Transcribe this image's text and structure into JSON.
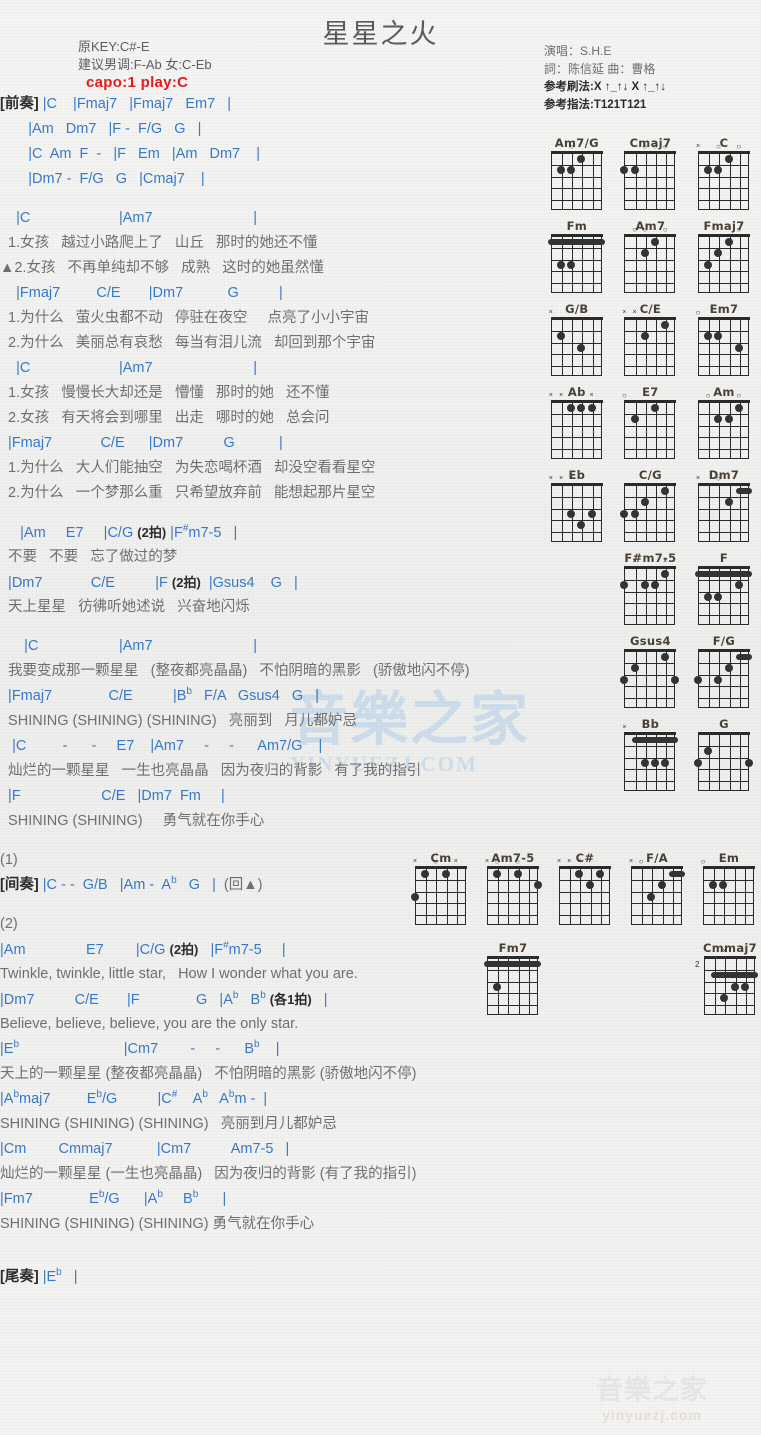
{
  "header": {
    "title": "星星之火",
    "orig_key": "原KEY:C#-E",
    "suggest_key": "建议男调:F-Ab 女:C-Eb",
    "capo": "capo:1 play:C",
    "singer": "演唱：S.H.E",
    "writer": "詞：陈信延   曲：曹格",
    "strum": "参考刷法:X ↑_↑↓ X ↑_↑↓",
    "fingering": "参考指法:T121T121"
  },
  "sections": {
    "intro_label": "[前奏]",
    "interlude_label": "[间奏]",
    "outro_label": "[尾奏]",
    "mark_1": "(1)",
    "mark_2": "(2)",
    "repeat_note": "(回▲)"
  },
  "lines": [
    {
      "t": "ch",
      "h": "<span class=\"blk\">[前奏]</span> |C    |Fmaj7   |Fmaj7   Em7   |"
    },
    {
      "t": "ch",
      "h": "       |Am   Dm7   |F -  F/G   G   |"
    },
    {
      "t": "ch",
      "h": "       |C  Am  F  -   |F   Em   |Am   Dm7    |"
    },
    {
      "t": "ch",
      "h": "       |Dm7 -  F/G   G   |Cmaj7    |"
    },
    {
      "t": "gap",
      "h": ""
    },
    {
      "t": "ch",
      "h": "    |C                      |Am7                         |"
    },
    {
      "t": "ly",
      "h": "  1.女孩   越过小路爬上了   山丘   那时的她还不懂"
    },
    {
      "t": "ly",
      "h": "▲2.女孩   不再单纯却不够   成熟   这时的她虽然懂"
    },
    {
      "t": "ch",
      "h": "    |Fmaj7         C/E       |Dm7           G          |"
    },
    {
      "t": "ly",
      "h": "  1.为什么   萤火虫都不动   停驻在夜空     点亮了小小宇宙"
    },
    {
      "t": "ly",
      "h": "  2.为什么   美丽总有哀愁   每当有泪儿流   却回到那个宇宙"
    },
    {
      "t": "ch",
      "h": "    |C                      |Am7                         |"
    },
    {
      "t": "ly",
      "h": "  1.女孩   慢慢长大却还是   懵懂   那时的她   还不懂"
    },
    {
      "t": "ly",
      "h": "  2.女孩   有天将会到哪里   出走   哪时的她   总会问"
    },
    {
      "t": "ch",
      "h": "  |Fmaj7            C/E      |Dm7          G           |"
    },
    {
      "t": "ly",
      "h": "  1.为什么   大人们能抽空   为失恋喝杯酒   却没空看看星空"
    },
    {
      "t": "ly",
      "h": "  2.为什么   一个梦那么重   只希望放弃前   能想起那片星空"
    },
    {
      "t": "gap",
      "h": ""
    },
    {
      "t": "ch",
      "h": "     |Am     E7     |C/G <span class=\"bt\">(2拍)</span> |F<sup>#</sup>m7-5   |"
    },
    {
      "t": "ly",
      "h": "  不要   不要   忘了做过的梦"
    },
    {
      "t": "ch",
      "h": "  |Dm7            C/E          |F <span class=\"bt\">(2拍)</span>  |Gsus4    G   |"
    },
    {
      "t": "ly",
      "h": "  天上星星   彷彿听她述说   兴奋地闪烁"
    },
    {
      "t": "gap",
      "h": ""
    },
    {
      "t": "ch",
      "h": "      |C                    |Am7                         |"
    },
    {
      "t": "ly",
      "h": "  我要变成那一颗星星   (整夜都亮晶晶)   不怕阴暗的黑影   (骄傲地闪不停)"
    },
    {
      "t": "ch",
      "h": "  |Fmaj7              C/E          |B<sup>b</sup>   F/A   Gsus4   G   |"
    },
    {
      "t": "ly",
      "h": "  SHINING (SHINING) (SHINING)   亮丽到   月儿都妒忌"
    },
    {
      "t": "ch",
      "h": "   |C         -      -     E7    |Am7     -     -      Am7/G    |"
    },
    {
      "t": "ly",
      "h": "  灿烂的一颗星星   一生也亮晶晶   因为夜归的背影   有了我的指引"
    },
    {
      "t": "ch",
      "h": "  |F                    C/E   |Dm7  Fm     |"
    },
    {
      "t": "ly",
      "h": "  SHINING (SHINING)     勇气就在你手心"
    },
    {
      "t": "gap",
      "h": ""
    },
    {
      "t": "ly",
      "h": "(1)"
    },
    {
      "t": "ch",
      "h": "<span class=\"blk\">[间奏]</span> |C - -  G/B   |Am -  A<sup>b</sup>   G   |  <span class=\"num\">(回▲)</span>"
    },
    {
      "t": "gap",
      "h": ""
    },
    {
      "t": "ly",
      "h": "(2)"
    },
    {
      "t": "ch",
      "h": "|Am               E7        |C/G <span class=\"bt\">(2拍)</span>   |F<sup>#</sup>m7-5     |"
    },
    {
      "t": "ly",
      "h": "Twinkle, twinkle, little star,   How I wonder what you are."
    },
    {
      "t": "ch",
      "h": "|Dm7          C/E       |F              G   |A<sup>b</sup>   B<sup>b</sup> <span class=\"bt\">(各1拍)</span>   |"
    },
    {
      "t": "ly",
      "h": "Believe, believe, believe, you are the only star."
    },
    {
      "t": "ch",
      "h": "|E<sup>b</sup>                          |Cm7        -     -      B<sup>b</sup>    |"
    },
    {
      "t": "ly",
      "h": "天上的一颗星星 (整夜都亮晶晶)   不怕阴暗的黑影 (骄傲地闪不停)"
    },
    {
      "t": "ch",
      "h": "|A<sup>b</sup>maj7         E<sup>b</sup>/G          |C<sup>#</sup>    A<sup>b</sup>   A<sup>b</sup>m -  |"
    },
    {
      "t": "ly",
      "h": "SHINING (SHINING) (SHINING)   亮丽到月儿都妒忌"
    },
    {
      "t": "ch",
      "h": "|Cm        Cmmaj7           |Cm7          Am7-5   |"
    },
    {
      "t": "ly",
      "h": "灿烂的一颗星星 (一生也亮晶晶)   因为夜归的背影 (有了我的指引)"
    },
    {
      "t": "ch",
      "h": "|Fm7              E<sup>b</sup>/G      |A<sup>b</sup>     B<sup>b</sup>      |"
    },
    {
      "t": "ly",
      "h": "SHINING (SHINING) (SHINING) 勇气就在你手心"
    },
    {
      "t": "gap",
      "h": ""
    },
    {
      "t": "gap",
      "h": ""
    },
    {
      "t": "ch",
      "h": "<span class=\"blk\">[尾奏]</span> |E<sup>b</sup>   |"
    }
  ],
  "chord_diagrams": [
    [
      {
        "name": "Am7/G",
        "marks": [
          {
            "s": 2,
            "m": "o"
          }
        ],
        "dots": [
          {
            "s": 1,
            "f": 2
          },
          {
            "s": 2,
            "f": 2
          },
          {
            "s": 3,
            "f": 1
          }
        ],
        "barre": null,
        "fret": ""
      },
      {
        "name": "Cmaj7",
        "marks": [
          {
            "s": 2,
            "m": "o"
          },
          {
            "s": 3,
            "m": "o"
          },
          {
            "s": 4,
            "m": "o"
          }
        ],
        "dots": [
          {
            "s": 0,
            "f": 2
          },
          {
            "s": 1,
            "f": 2
          }
        ],
        "barre": null,
        "fret": ""
      },
      {
        "name": "C",
        "marks": [
          {
            "s": 0,
            "m": "x"
          },
          {
            "s": 2,
            "m": "o"
          },
          {
            "s": 4,
            "m": "o"
          }
        ],
        "dots": [
          {
            "s": 1,
            "f": 2
          },
          {
            "s": 2,
            "f": 2
          },
          {
            "s": 3,
            "f": 1
          }
        ],
        "barre": null,
        "fret": ""
      }
    ],
    [
      {
        "name": "Fm",
        "marks": [],
        "dots": [
          {
            "s": 1,
            "f": 3
          },
          {
            "s": 2,
            "f": 3
          }
        ],
        "barre": {
          "f": 1,
          "from": 0,
          "to": 5
        },
        "fret": ""
      },
      {
        "name": "Am7",
        "marks": [
          {
            "s": 1,
            "m": "o"
          },
          {
            "s": 2,
            "m": "o"
          },
          {
            "s": 4,
            "m": "o"
          }
        ],
        "dots": [
          {
            "s": 2,
            "f": 2
          },
          {
            "s": 3,
            "f": 1
          }
        ],
        "barre": null,
        "fret": ""
      },
      {
        "name": "Fmaj7",
        "marks": [
          {
            "s": 4,
            "m": "o"
          }
        ],
        "dots": [
          {
            "s": 1,
            "f": 3
          },
          {
            "s": 2,
            "f": 2
          },
          {
            "s": 3,
            "f": 1
          }
        ],
        "barre": null,
        "fret": ""
      }
    ],
    [
      {
        "name": "G/B",
        "marks": [
          {
            "s": 0,
            "m": "x"
          }
        ],
        "dots": [
          {
            "s": 1,
            "f": 2
          },
          {
            "s": 3,
            "f": 3
          }
        ],
        "barre": null,
        "fret": ""
      },
      {
        "name": "C/E",
        "marks": [
          {
            "s": 0,
            "m": "x"
          },
          {
            "s": 1,
            "m": "x"
          }
        ],
        "dots": [
          {
            "s": 2,
            "f": 2
          },
          {
            "s": 4,
            "f": 1
          }
        ],
        "barre": null,
        "fret": ""
      },
      {
        "name": "Em7",
        "marks": [
          {
            "s": 0,
            "m": "o"
          }
        ],
        "dots": [
          {
            "s": 1,
            "f": 2
          },
          {
            "s": 2,
            "f": 2
          },
          {
            "s": 4,
            "f": 3
          }
        ],
        "barre": null,
        "fret": ""
      }
    ],
    [
      {
        "name": "Ab",
        "marks": [
          {
            "s": 0,
            "m": "x"
          },
          {
            "s": 1,
            "m": "x"
          },
          {
            "s": 4,
            "m": "x"
          }
        ],
        "dots": [
          {
            "s": 2,
            "f": 1
          },
          {
            "s": 3,
            "f": 1
          },
          {
            "s": 4,
            "f": 1
          }
        ],
        "barre": null,
        "fret": ""
      },
      {
        "name": "E7",
        "marks": [
          {
            "s": 0,
            "m": "o"
          }
        ],
        "dots": [
          {
            "s": 1,
            "f": 2
          },
          {
            "s": 3,
            "f": 1
          }
        ],
        "barre": null,
        "fret": ""
      },
      {
        "name": "Am",
        "marks": [
          {
            "s": 1,
            "m": "o"
          },
          {
            "s": 4,
            "m": "o"
          }
        ],
        "dots": [
          {
            "s": 2,
            "f": 2
          },
          {
            "s": 3,
            "f": 2
          },
          {
            "s": 4,
            "f": 1
          }
        ],
        "barre": null,
        "fret": ""
      }
    ],
    [
      {
        "name": "Eb",
        "marks": [
          {
            "s": 0,
            "m": "x"
          },
          {
            "s": 1,
            "m": "x"
          },
          {
            "s": 2,
            "m": "x"
          }
        ],
        "dots": [
          {
            "s": 2,
            "f": 3
          },
          {
            "s": 3,
            "f": 4
          },
          {
            "s": 4,
            "f": 3
          }
        ],
        "barre": null,
        "fret": ""
      },
      {
        "name": "C/G",
        "marks": [],
        "dots": [
          {
            "s": 0,
            "f": 3
          },
          {
            "s": 1,
            "f": 3
          },
          {
            "s": 2,
            "f": 2
          },
          {
            "s": 4,
            "f": 1
          }
        ],
        "barre": null,
        "fret": ""
      },
      {
        "name": "Dm7",
        "marks": [
          {
            "s": 0,
            "m": "x"
          },
          {
            "s": 2,
            "m": "o"
          }
        ],
        "dots": [
          {
            "s": 3,
            "f": 2
          }
        ],
        "barre": {
          "f": 1,
          "from": 4,
          "to": 5
        },
        "fret": ""
      }
    ],
    [
      {
        "name": "",
        "marks": [],
        "dots": [],
        "barre": null,
        "fret": ""
      },
      {
        "name": "F#m7-5",
        "marks": [
          {
            "s": 1,
            "m": "x"
          },
          {
            "s": 4,
            "m": "x"
          }
        ],
        "dots": [
          {
            "s": 0,
            "f": 2
          },
          {
            "s": 2,
            "f": 2
          },
          {
            "s": 3,
            "f": 2
          },
          {
            "s": 4,
            "f": 1
          }
        ],
        "barre": null,
        "fret": ""
      },
      {
        "name": "F",
        "marks": [],
        "dots": [
          {
            "s": 1,
            "f": 3
          },
          {
            "s": 2,
            "f": 3
          },
          {
            "s": 4,
            "f": 2
          }
        ],
        "barre": {
          "f": 1,
          "from": 0,
          "to": 5
        },
        "fret": ""
      }
    ],
    [
      {
        "name": "",
        "marks": [],
        "dots": [],
        "barre": null,
        "fret": ""
      },
      {
        "name": "Gsus4",
        "marks": [],
        "dots": [
          {
            "s": 0,
            "f": 3
          },
          {
            "s": 1,
            "f": 2
          },
          {
            "s": 4,
            "f": 1
          },
          {
            "s": 5,
            "f": 3
          }
        ],
        "barre": null,
        "fret": ""
      },
      {
        "name": "F/G",
        "marks": [
          {
            "s": 3,
            "m": "x"
          }
        ],
        "dots": [
          {
            "s": 0,
            "f": 3
          },
          {
            "s": 2,
            "f": 3
          },
          {
            "s": 3,
            "f": 2
          }
        ],
        "barre": {
          "f": 1,
          "from": 4,
          "to": 5
        },
        "fret": ""
      }
    ],
    [
      {
        "name": "",
        "marks": [],
        "dots": [],
        "barre": null,
        "fret": ""
      },
      {
        "name": "Bb",
        "marks": [
          {
            "s": 0,
            "m": "x"
          }
        ],
        "dots": [
          {
            "s": 2,
            "f": 3
          },
          {
            "s": 3,
            "f": 3
          },
          {
            "s": 4,
            "f": 3
          }
        ],
        "barre": {
          "f": 1,
          "from": 1,
          "to": 5
        },
        "fret": ""
      },
      {
        "name": "G",
        "marks": [],
        "dots": [
          {
            "s": 0,
            "f": 3
          },
          {
            "s": 1,
            "f": 2
          },
          {
            "s": 5,
            "f": 3
          }
        ],
        "barre": null,
        "fret": ""
      }
    ]
  ],
  "chord_diagrams_row2": [
    {
      "name": "Cm",
      "marks": [
        {
          "s": 0,
          "m": "x"
        },
        {
          "s": 2,
          "m": "o"
        },
        {
          "s": 4,
          "m": "x"
        }
      ],
      "dots": [
        {
          "s": 1,
          "f": 1
        },
        {
          "s": 3,
          "f": 1
        },
        {
          "s": 0,
          "f": 3
        }
      ],
      "barre": null,
      "fret": ""
    },
    {
      "name": "Am7-5",
      "marks": [
        {
          "s": 0,
          "m": "x"
        },
        {
          "s": 1,
          "m": "o"
        },
        {
          "s": 3,
          "m": "o"
        }
      ],
      "dots": [
        {
          "s": 1,
          "f": 1
        },
        {
          "s": 3,
          "f": 1
        },
        {
          "s": 5,
          "f": 2
        }
      ],
      "barre": null,
      "fret": ""
    },
    {
      "name": "C#",
      "marks": [
        {
          "s": 0,
          "m": "x"
        },
        {
          "s": 1,
          "m": "x"
        },
        {
          "s": 2,
          "m": "x"
        }
      ],
      "dots": [
        {
          "s": 2,
          "f": 1
        },
        {
          "s": 4,
          "f": 1
        },
        {
          "s": 3,
          "f": 2
        }
      ],
      "barre": null,
      "fret": ""
    },
    {
      "name": "F/A",
      "marks": [
        {
          "s": 0,
          "m": "x"
        },
        {
          "s": 1,
          "m": "o"
        }
      ],
      "dots": [
        {
          "s": 3,
          "f": 2
        },
        {
          "s": 2,
          "f": 3
        }
      ],
      "barre": {
        "f": 1,
        "from": 4,
        "to": 5
      },
      "fret": ""
    },
    {
      "name": "Em",
      "marks": [
        {
          "s": 0,
          "m": "o"
        }
      ],
      "dots": [
        {
          "s": 1,
          "f": 2
        },
        {
          "s": 2,
          "f": 2
        }
      ],
      "barre": null,
      "fret": ""
    }
  ],
  "chord_diagrams_fm7": {
    "name": "Fm7",
    "marks": [],
    "dots": [
      {
        "s": 1,
        "f": 3
      }
    ],
    "barre": {
      "f": 1,
      "from": 0,
      "to": 5
    },
    "fret": ""
  },
  "chord_diagrams_cmmaj7": {
    "name": "Cmmaj7",
    "marks": [
      {
        "s": 2,
        "m": "x"
      }
    ],
    "dots": [
      {
        "s": 3,
        "f": 3
      },
      {
        "s": 4,
        "f": 3
      },
      {
        "s": 2,
        "f": 4
      }
    ],
    "barre": {
      "f": 2,
      "from": 1,
      "to": 5
    },
    "fret": "2"
  },
  "watermark": {
    "center_text": "音樂之家",
    "center_url": "YINYUEZJ.COM",
    "br_text": "音樂之家",
    "br_url": "yinyuezj.com"
  }
}
